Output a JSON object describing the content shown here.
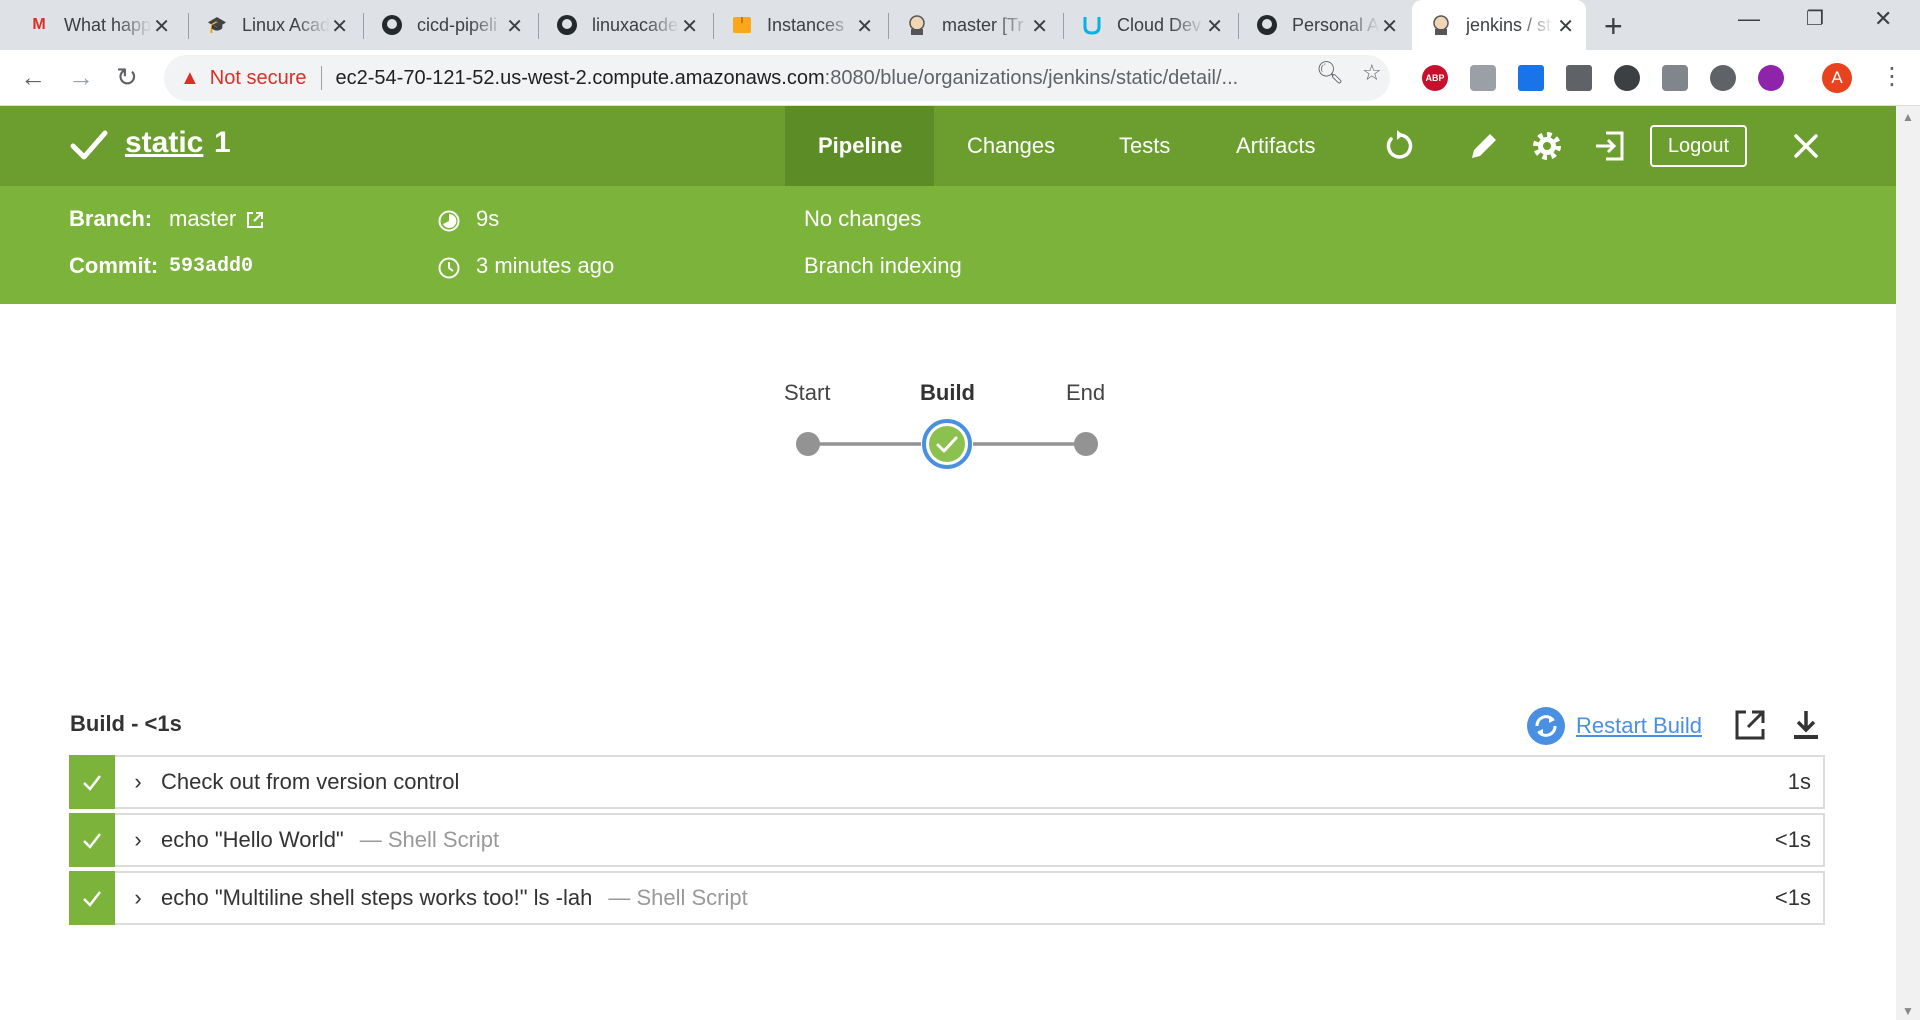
{
  "browser": {
    "tabs": [
      {
        "title": "What happ",
        "icon": "gmail-icon"
      },
      {
        "title": "Linux Acad",
        "icon": "graduation-cap-icon"
      },
      {
        "title": "cicd-pipeli",
        "icon": "github-icon"
      },
      {
        "title": "linuxacade",
        "icon": "github-icon"
      },
      {
        "title": "Instances",
        "icon": "aws-box-icon"
      },
      {
        "title": "master [Tr",
        "icon": "jenkins-icon"
      },
      {
        "title": "Cloud Dev",
        "icon": "udacity-icon"
      },
      {
        "title": "Personal A",
        "icon": "github-icon"
      },
      {
        "title": "jenkins / st",
        "icon": "jenkins-icon"
      }
    ],
    "not_secure": "Not secure",
    "url_host": "ec2-54-70-121-52.us-west-2.compute.amazonaws.com",
    "url_rest": ":8080/blue/organizations/jenkins/static/detail/...",
    "avatar_letter": "A",
    "abp_label": "ABP"
  },
  "run": {
    "name": "static",
    "number": "1"
  },
  "nav": {
    "pipeline": "Pipeline",
    "changes": "Changes",
    "tests": "Tests",
    "artifacts": "Artifacts",
    "logout": "Logout"
  },
  "info": {
    "branch_label": "Branch:",
    "branch_value": "master",
    "commit_label": "Commit:",
    "commit_value": "593add0",
    "duration": "9s",
    "started": "3 minutes ago",
    "changes": "No changes",
    "cause": "Branch indexing"
  },
  "graph": {
    "nodes": [
      "Start",
      "Build",
      "End"
    ],
    "selected": "Build"
  },
  "steps_panel": {
    "title": "Build - <1s",
    "restart_label": "Restart Build",
    "steps": [
      {
        "text": "Check out from version control",
        "type": "",
        "duration": "1s"
      },
      {
        "text": "echo \"Hello World\"",
        "type": "— Shell Script",
        "duration": "<1s"
      },
      {
        "text": "echo \"Multiline shell steps works too!\" ls -lah",
        "type": "— Shell Script",
        "duration": "<1s"
      }
    ]
  },
  "colors": {
    "header_dark": "#6b9e2f",
    "header_light": "#7cb33a",
    "link_blue": "#4a90e2"
  }
}
